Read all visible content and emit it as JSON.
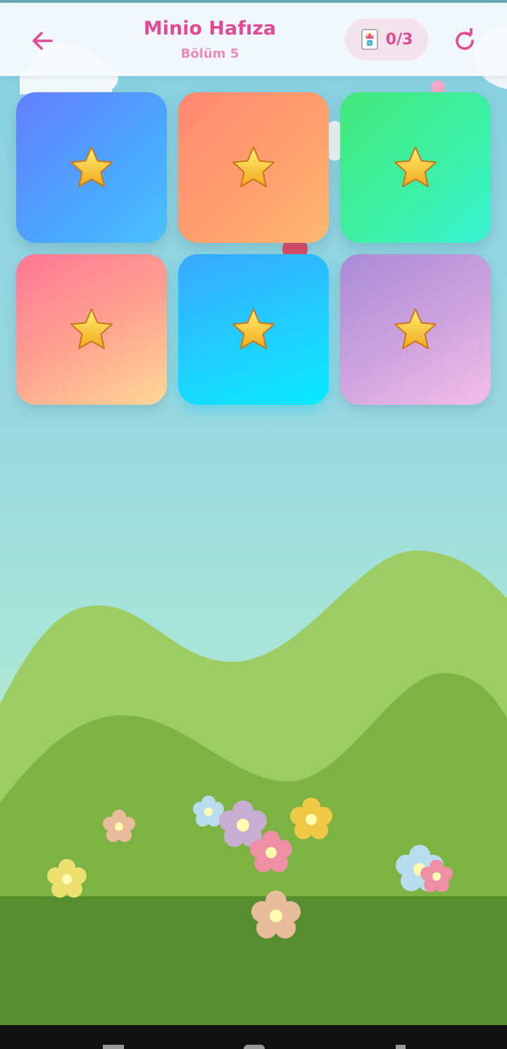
{
  "header": {
    "back_icon": "arrow-left-icon",
    "title": "Minio Hafıza",
    "subtitle": "Bölüm 5",
    "counter": {
      "icon": "joker-card-icon",
      "text": "0/3"
    },
    "restart_icon": "refresh-icon"
  },
  "cards": [
    {
      "face": "star-icon",
      "color": "#4aa7ff"
    },
    {
      "face": "star-icon",
      "color": "#ff9f6f"
    },
    {
      "face": "star-icon",
      "color": "#3cf0a8"
    },
    {
      "face": "star-icon",
      "color": "#ffa090"
    },
    {
      "face": "star-icon",
      "color": "#1ed2ff"
    },
    {
      "face": "star-icon",
      "color": "#cfa4de"
    }
  ],
  "colors": {
    "accent": "#e24a96",
    "sky": "#84cfe1",
    "hill_light": "#9dcc65",
    "hill_mid": "#7db343",
    "ground": "#568d2f"
  }
}
